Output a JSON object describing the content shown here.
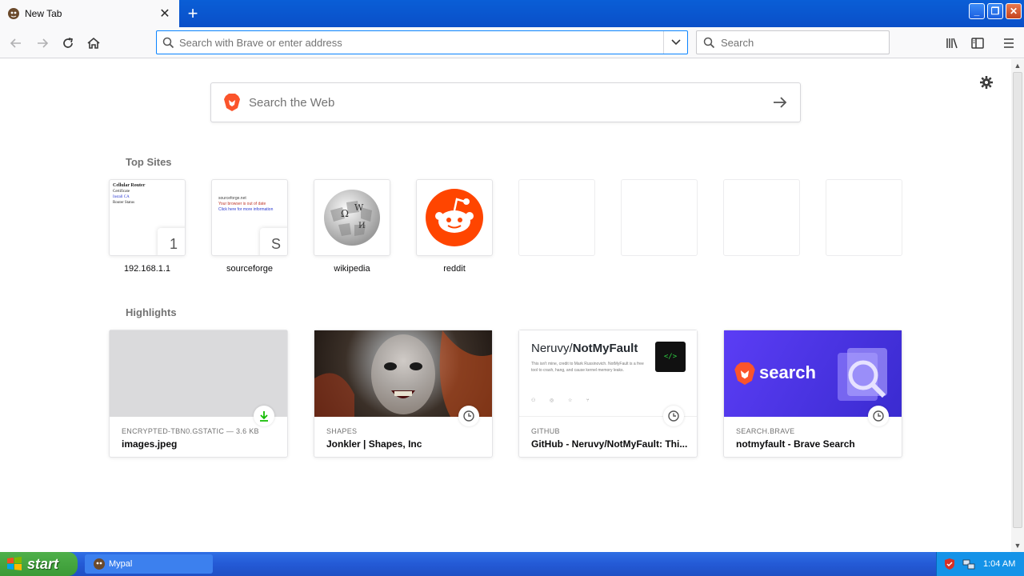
{
  "tab": {
    "title": "New Tab",
    "favicon": "mypal-icon"
  },
  "toolbar": {
    "url_placeholder": "Search with Brave or enter address",
    "search_placeholder": "Search"
  },
  "newtab": {
    "web_search_placeholder": "Search the Web",
    "top_sites_heading": "Top Sites",
    "highlights_heading": "Highlights",
    "top_sites": [
      {
        "label": "192.168.1.1",
        "badge": "1"
      },
      {
        "label": "sourceforge",
        "badge": "S"
      },
      {
        "label": "wikipedia"
      },
      {
        "label": "reddit"
      }
    ],
    "router_preview": {
      "title": "Cellular Router",
      "line1": "Certificate",
      "line2": "Install CA",
      "line3": "Router Status"
    },
    "sf_preview": {
      "site": "sourceforge.net",
      "line1": "Your browser is out of date",
      "line2": "Click here for more information"
    },
    "highlights": [
      {
        "source": "ENCRYPTED-TBN0.GSTATIC — 3.6 KB",
        "title": "images.jpeg",
        "badge": "download-icon"
      },
      {
        "source": "SHAPES",
        "title": "Jonkler | Shapes, Inc",
        "badge": "clock-icon"
      },
      {
        "source": "GITHUB",
        "title": "GitHub - Neruvy/NotMyFault: Thi...",
        "badge": "clock-icon"
      },
      {
        "source": "SEARCH.BRAVE",
        "title": "notmyfault - Brave Search",
        "badge": "clock-icon"
      }
    ],
    "github_card": {
      "repo_owner": "Neruvy/",
      "repo_name": "NotMyFault",
      "description": "This isn't mine, credit to Mark Russinovich. NotMyFault is a free tool to crash, hang, and cause kernel memory leaks."
    },
    "brave_card": {
      "word": "search"
    }
  },
  "taskbar": {
    "start_label": "start",
    "task_label": "Mypal",
    "clock": "1:04 AM"
  },
  "colors": {
    "accent": "#0a84ff",
    "reddit": "#ff4500",
    "brave_orange": "#fb542b",
    "brave_purple": "#4436dc"
  }
}
